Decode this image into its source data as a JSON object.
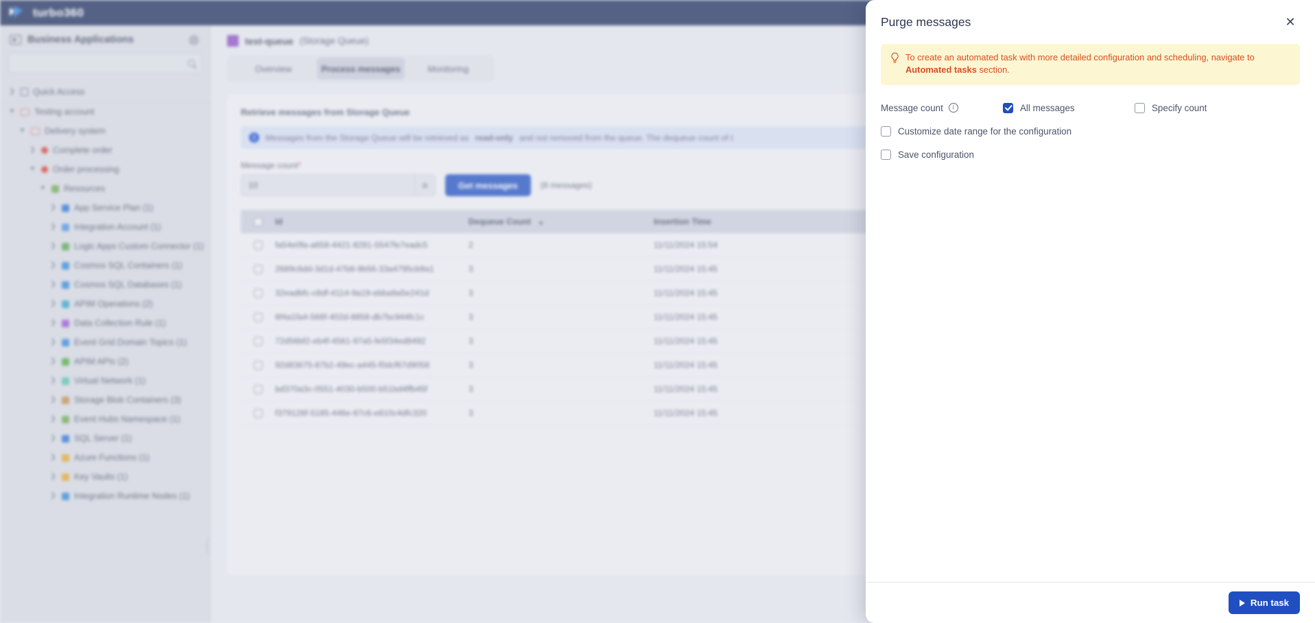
{
  "topbar": {
    "brand": "turbo360"
  },
  "sidebar": {
    "title": "Business Applications",
    "search_placeholder": "",
    "search_value": "",
    "items": [
      {
        "label": "Quick Access",
        "icon": "bookmark-icon",
        "color": "#5d6479",
        "depth": 0,
        "expanded": false,
        "separator": true
      },
      {
        "label": "Testing account",
        "icon": "folder-icon",
        "color": "#d4767a",
        "depth": 0,
        "expanded": true
      },
      {
        "label": "Delivery system",
        "icon": "folder-icon",
        "color": "#d4767a",
        "depth": 1,
        "expanded": true
      },
      {
        "label": "Complete order",
        "icon": "dot-icon",
        "color": "#d93a36",
        "depth": 2,
        "expanded": false
      },
      {
        "label": "Order processing",
        "icon": "dot-icon",
        "color": "#d93a36",
        "depth": 2,
        "expanded": true
      },
      {
        "label": "Resources",
        "icon": "square-icon",
        "color": "#6aa84f",
        "depth": 3,
        "expanded": true
      },
      {
        "label": "App Service Plan (1)",
        "icon": "app-service-plan-icon",
        "color": "#2a6fd6",
        "depth": 4,
        "expanded": false
      },
      {
        "label": "Integration Account (1)",
        "icon": "integration-account-icon",
        "color": "#4d8de0",
        "depth": 4,
        "expanded": false
      },
      {
        "label": "Logic Apps Custom Connector (1)",
        "icon": "logic-apps-connector-icon",
        "color": "#53a64d",
        "depth": 4,
        "expanded": false
      },
      {
        "label": "Cosmos SQL Containers (1)",
        "icon": "cosmos-sql-container-icon",
        "color": "#2f86d8",
        "depth": 4,
        "expanded": false
      },
      {
        "label": "Cosmos SQL Databases (1)",
        "icon": "cosmos-sql-database-icon",
        "color": "#2f86d8",
        "depth": 4,
        "expanded": false
      },
      {
        "label": "APIM Operations (2)",
        "icon": "apim-operations-icon",
        "color": "#2fa3c9",
        "depth": 4,
        "expanded": false
      },
      {
        "label": "Data Collection Rule (1)",
        "icon": "data-collection-rule-icon",
        "color": "#9b4fd4",
        "depth": 4,
        "expanded": false
      },
      {
        "label": "Event Grid Domain Topics (1)",
        "icon": "event-grid-domain-topics-icon",
        "color": "#2f86d8",
        "depth": 4,
        "expanded": false
      },
      {
        "label": "APIM APIs (2)",
        "icon": "apim-apis-icon",
        "color": "#4fa83e",
        "depth": 4,
        "expanded": false
      },
      {
        "label": "Virtual Network (1)",
        "icon": "virtual-network-icon",
        "color": "#54bfae",
        "depth": 4,
        "expanded": false
      },
      {
        "label": "Storage Blob Containers (3)",
        "icon": "storage-blob-containers-icon",
        "color": "#c08a4e",
        "depth": 4,
        "expanded": false
      },
      {
        "label": "Event Hubs Namespace (1)",
        "icon": "event-hubs-namespace-icon",
        "color": "#6aa84f",
        "depth": 4,
        "expanded": false
      },
      {
        "label": "SQL Server (1)",
        "icon": "sql-server-icon",
        "color": "#2a6fd6",
        "depth": 4,
        "expanded": false
      },
      {
        "label": "Azure Functions (1)",
        "icon": "azure-functions-icon",
        "color": "#e0a52f",
        "depth": 4,
        "expanded": false
      },
      {
        "label": "Key Vaults (1)",
        "icon": "key-vaults-icon",
        "color": "#e0a52f",
        "depth": 4,
        "expanded": false
      },
      {
        "label": "Integration Runtime Nodes (1)",
        "icon": "integration-runtime-nodes-icon",
        "color": "#2f86d8",
        "depth": 4,
        "expanded": false
      }
    ]
  },
  "main": {
    "breadcrumb_name": "test-queue",
    "breadcrumb_type": "(Storage Queue)",
    "tabs": [
      {
        "label": "Overview",
        "active": false
      },
      {
        "label": "Process messages",
        "active": true
      },
      {
        "label": "Monitoring",
        "active": false
      }
    ],
    "panel_title": "Retrieve messages from Storage Queue",
    "info_text_1": "Messages from the Storage Queue will be retrieved as ",
    "info_text_bold": "read-only",
    "info_text_2": " and not removed from the queue. The dequeue count of t",
    "info_icon_glyph": "i",
    "field_label": "Message count",
    "field_required_mark": "*",
    "count_value": "10",
    "get_messages_label": "Get messages",
    "messages_note": "(8 messages)",
    "table": {
      "columns": [
        "Id",
        "Dequeue Count",
        "Insertion Time"
      ],
      "sort_indicator": "▲",
      "rows": [
        {
          "id": "fa54e0fa-a658-4421-8281-5547fe7eadc5",
          "dequeue": "2",
          "inserted": "11/11/2024 15:54"
        },
        {
          "id": "2689c6dd-3d1d-47b8-9b56-33a4795cb9a1",
          "dequeue": "3",
          "inserted": "11/11/2024 15:45"
        },
        {
          "id": "32eadbfc-c8df-4114-9a19-ebba9a5e241d",
          "dequeue": "3",
          "inserted": "11/11/2024 15:45"
        },
        {
          "id": "6f4a1fa4-566f-402d-8858-db7bc944fc1c",
          "dequeue": "3",
          "inserted": "11/11/2024 15:45"
        },
        {
          "id": "72d56bf2-eb4f-4561-97a5-fe5f34ed8492",
          "dequeue": "3",
          "inserted": "11/11/2024 15:45"
        },
        {
          "id": "92d83675-87b2-49ec-a445-f0dcf67d9058",
          "dequeue": "3",
          "inserted": "11/11/2024 15:45"
        },
        {
          "id": "bd370a3c-0551-4030-b500-b51bd4ffb45f",
          "dequeue": "3",
          "inserted": "11/11/2024 15:45"
        },
        {
          "id": "f379126f-5185-446e-87c6-e810c4dfc320",
          "dequeue": "3",
          "inserted": "11/11/2024 15:45"
        }
      ]
    }
  },
  "modal": {
    "title": "Purge messages",
    "close_glyph": "✕",
    "tip_text_1": "To create an automated task with more detailed configuration and scheduling, navigate to ",
    "tip_text_bold": "Automated tasks",
    "tip_text_2": " section.",
    "message_count_label": "Message count",
    "info_glyph": "i",
    "all_messages_label": "All messages",
    "all_messages_checked": true,
    "specify_count_label": "Specify count",
    "specify_count_checked": false,
    "customize_date_label": "Customize date range for the configuration",
    "customize_date_checked": false,
    "save_config_label": "Save configuration",
    "save_config_checked": false,
    "run_task_label": "Run task"
  },
  "colors": {
    "brand_navy": "#1d2f5e",
    "accent_blue": "#1f4fc0",
    "tip_bg": "#fdf6d3",
    "tip_text": "#d94f1e"
  }
}
